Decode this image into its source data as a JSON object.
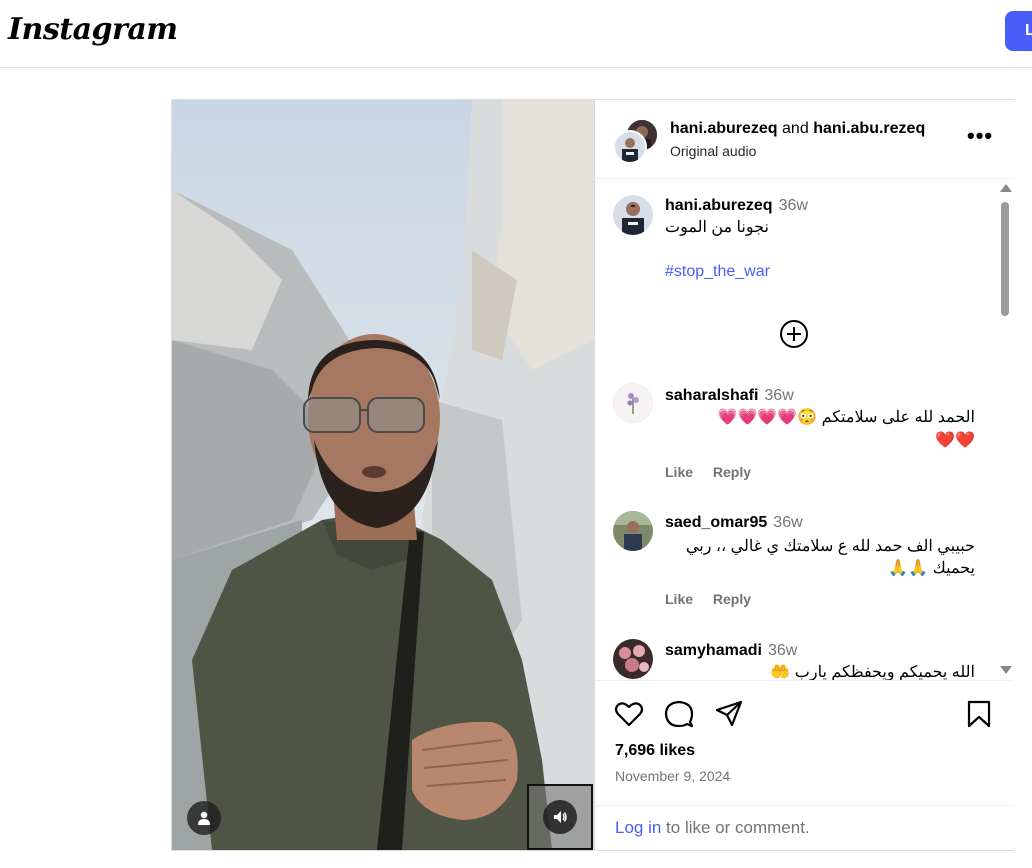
{
  "app": {
    "logo_text": "Instagram",
    "top_login_label": "L"
  },
  "post": {
    "owner": "hani.aburezeq",
    "collab_connector": "and",
    "collaborator": "hani.abu.rezeq",
    "audio_label": "Original audio",
    "more_icon": "more-horizontal-icon"
  },
  "caption": {
    "username": "hani.aburezeq",
    "time": "36w",
    "text": "نجونا من الموت",
    "hashtag": "#stop_the_war"
  },
  "comments": [
    {
      "username": "saharalshafi",
      "time": "36w",
      "text_line1": "الحمد لله على سلامتكم 😳💗💗💗💗",
      "text_line2": "❤️❤️",
      "like_label": "Like",
      "reply_label": "Reply"
    },
    {
      "username": "saed_omar95",
      "time": "36w",
      "text_line1": "حبيبي الف حمد لله ع سلامتك ي غالي ،، ربي",
      "text_line2": "يحميك 🙏🙏",
      "like_label": "Like",
      "reply_label": "Reply"
    },
    {
      "username": "samyhamadi",
      "time": "36w",
      "text_line1": "الله يحميكم ويحفظكم يارب 🤲"
    }
  ],
  "engagement": {
    "likes": "7,696 likes",
    "date": "November 9, 2024",
    "login_link": "Log in",
    "login_suffix": " to like or comment."
  },
  "colors": {
    "accent": "#4a5df9",
    "muted": "#737373",
    "border": "#dbdbdb"
  }
}
